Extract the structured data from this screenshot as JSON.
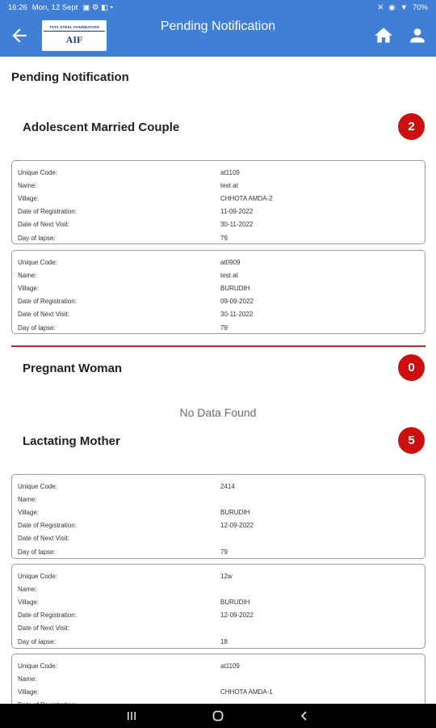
{
  "status_bar": {
    "time": "16:26",
    "date": "Mon, 12 Sept",
    "battery": "70%"
  },
  "app_bar": {
    "title": "Pending Notification",
    "logo_top": "TATA STEEL FOUNDATION",
    "logo_bottom": "AIF"
  },
  "page": {
    "heading": "Pending Notification",
    "labels": {
      "unique_code": "Unique Code:",
      "name": "Name:",
      "village": "Village:",
      "date_of_registration": "Date of Registration:",
      "date_of_next_visit": "Date of Next Visit:",
      "day_of_lapse": "Day of lapse:"
    },
    "no_data_text": "No Data Found"
  },
  "sections": [
    {
      "title": "Adolescent Married Couple",
      "count": "2",
      "records": [
        {
          "unique_code": "at1109",
          "name": "test at",
          "village": "CHHOTA AMDA-2",
          "date_of_registration": "11-09-2022",
          "date_of_next_visit": "30-11-2022",
          "day_of_lapse": "79"
        },
        {
          "unique_code": "at0909",
          "name": "test at",
          "village": "BURUDIH",
          "date_of_registration": "09-09-2022",
          "date_of_next_visit": "30-11-2022",
          "day_of_lapse": "79"
        }
      ]
    },
    {
      "title": "Pregnant Woman",
      "count": "0",
      "records": []
    },
    {
      "title": "Lactating Mother",
      "count": "5",
      "records": [
        {
          "unique_code": "2414",
          "name": "",
          "village": "BURUDIH",
          "date_of_registration": "12-09-2022",
          "date_of_next_visit": "",
          "day_of_lapse": "79"
        },
        {
          "unique_code": "12w",
          "name": "",
          "village": "BURUDIH",
          "date_of_registration": "12-09-2022",
          "date_of_next_visit": "",
          "day_of_lapse": "18"
        },
        {
          "unique_code": "at1109",
          "name": "",
          "village": "CHHOTA AMDA-1",
          "date_of_registration": "",
          "date_of_next_visit": "",
          "day_of_lapse": ""
        }
      ]
    }
  ],
  "colors": {
    "app_bar": "#3f7fd6",
    "badge": "#cc1010",
    "divider": "#b52b2b"
  }
}
